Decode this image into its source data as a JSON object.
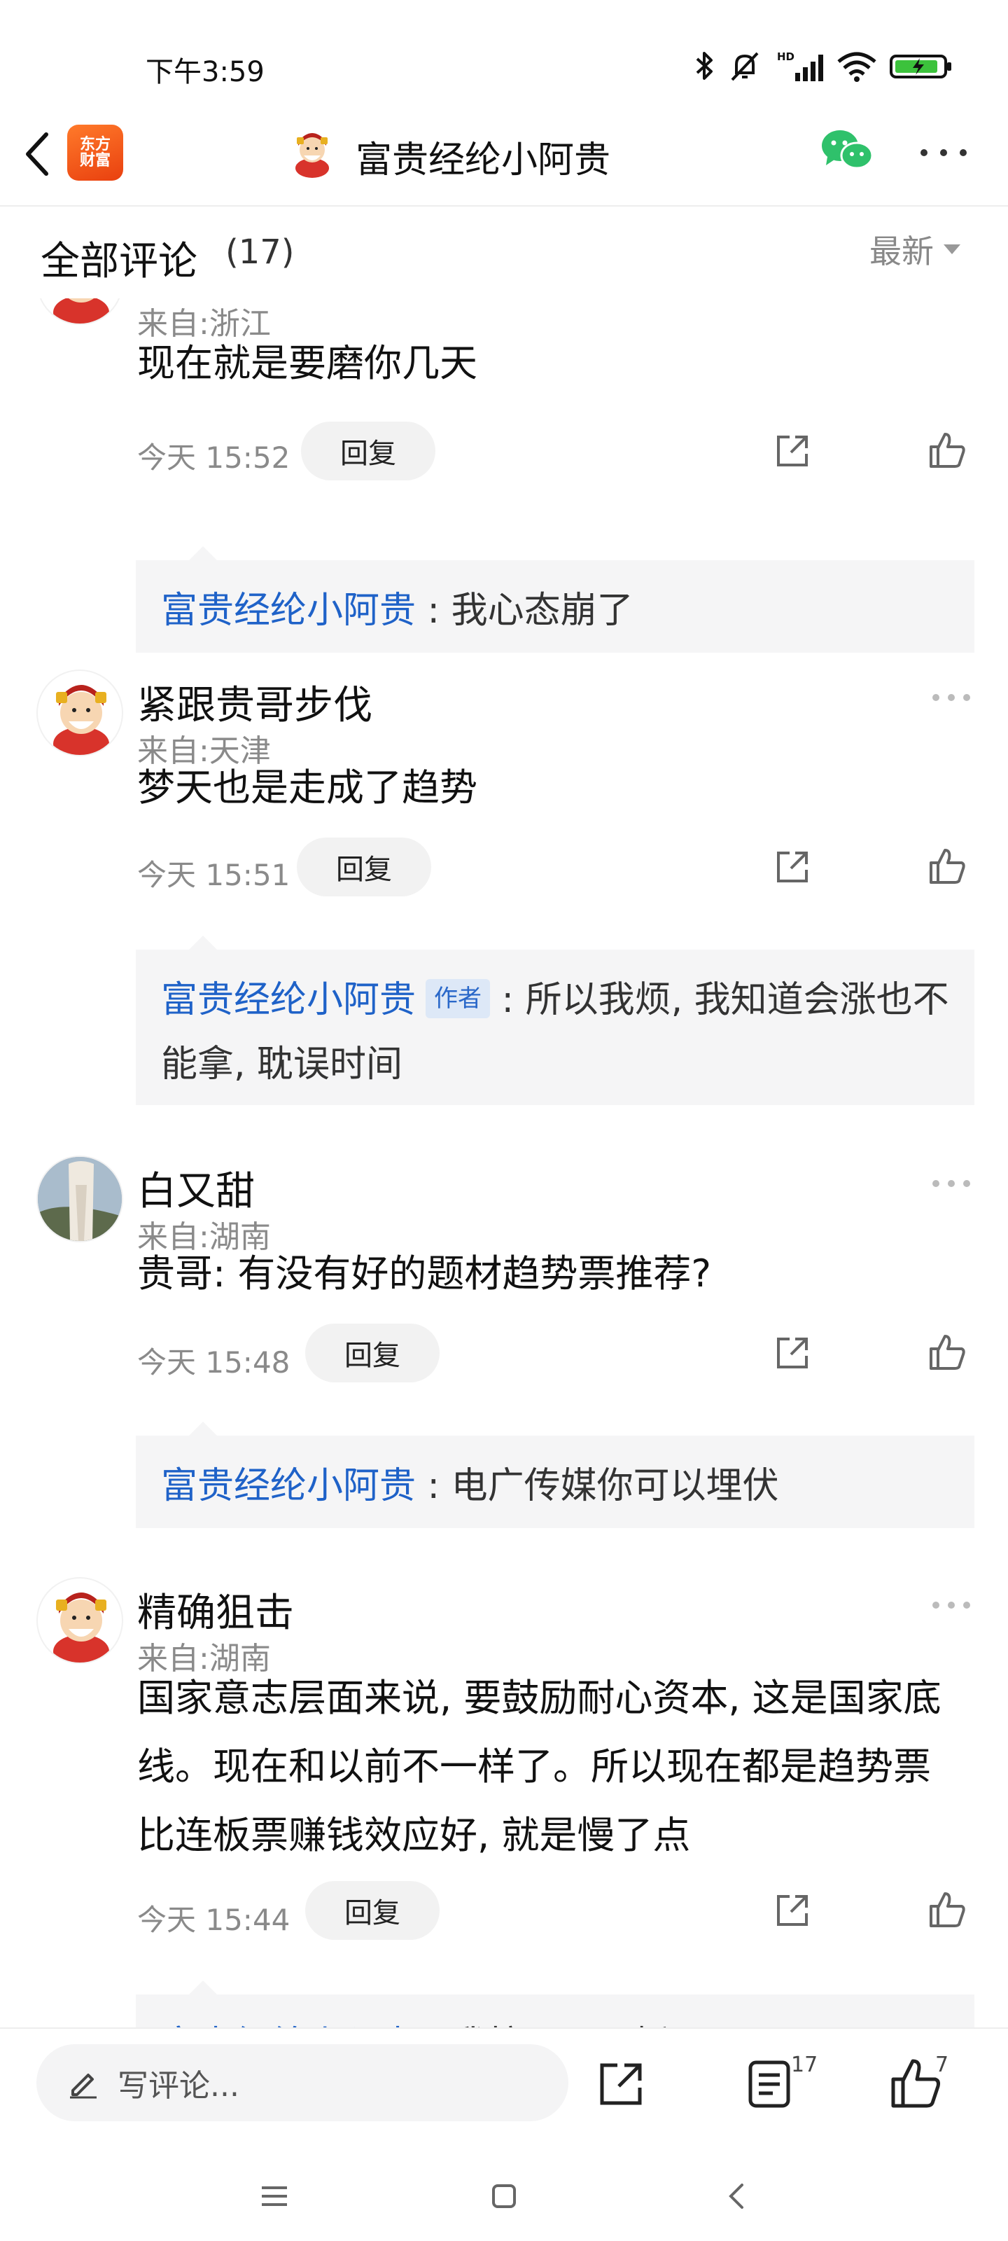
{
  "status_bar": {
    "time": "下午3:59",
    "icons": [
      "bluetooth-icon",
      "bell-muted-icon",
      "hd-signal-icon",
      "wifi-icon",
      "battery-charging-icon"
    ]
  },
  "header": {
    "logo_line1": "东方",
    "logo_line2": "财富",
    "title": "富贵经纶小阿贵"
  },
  "comments_section": {
    "title": "全部评论",
    "count": "(17)",
    "sort": "最新"
  },
  "comments": [
    {
      "location": "来自:浙江",
      "text": "现在就是要磨你几天",
      "time": "今天 15:52",
      "reply_label": "回复",
      "reply": {
        "user": "富贵经纶小阿贵",
        "author_tag": "",
        "text": ": 我心态崩了"
      }
    },
    {
      "name": "紧跟贵哥步伐",
      "location": "来自:天津",
      "text": "梦天也是走成了趋势",
      "time": "今天 15:51",
      "reply_label": "回复",
      "reply": {
        "user": "富贵经纶小阿贵",
        "author_tag": "作者",
        "text": ": 所以我烦, 我知道会涨也不能拿, 耽误时间"
      }
    },
    {
      "name": "白又甜",
      "location": "来自:湖南",
      "text": "贵哥: 有没有好的题材趋势票推荐?",
      "time": "今天 15:48",
      "reply_label": "回复",
      "reply": {
        "user": "富贵经纶小阿贵",
        "author_tag": "",
        "text": ": 电广传媒你可以埋伏"
      }
    },
    {
      "name": "精确狙击",
      "location": "来自:湖南",
      "text": "国家意志层面来说, 要鼓励耐心资本, 这是国家底线。现在和以前不一样了。所以现在都是趋势票比连板票赚钱效应好, 就是慢了点",
      "time": "今天 15:44",
      "reply_label": "回复",
      "reply": {
        "user": "富贵经纶小阿贵",
        "author_tag": "",
        "text": ": 我拉了三天板"
      }
    }
  ],
  "bottom_bar": {
    "input_placeholder": "写评论...",
    "comment_count": "17",
    "like_count": "7"
  },
  "colors": {
    "link_blue": "#1f62c8",
    "logo_orange": "#f0581b",
    "wechat_green": "#2fc16b"
  }
}
